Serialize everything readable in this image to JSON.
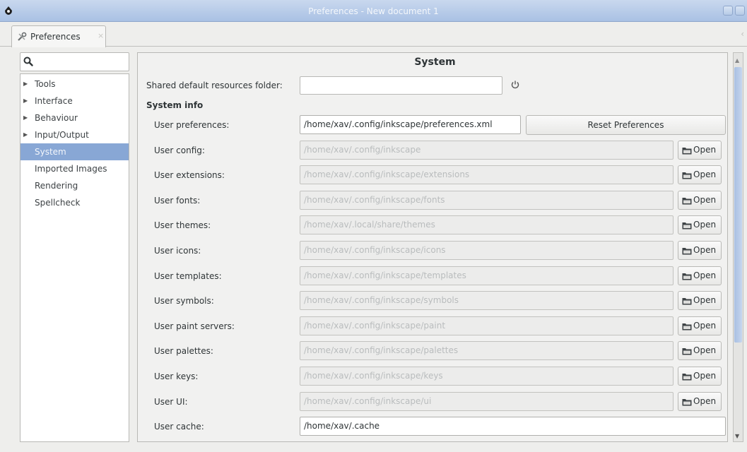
{
  "window": {
    "title": "Preferences - New document 1"
  },
  "tab": {
    "label": "Preferences",
    "close": "×"
  },
  "sidebar": {
    "search_placeholder": "",
    "items": [
      {
        "label": "Tools",
        "expandable": true,
        "selected": false
      },
      {
        "label": "Interface",
        "expandable": true,
        "selected": false
      },
      {
        "label": "Behaviour",
        "expandable": true,
        "selected": false
      },
      {
        "label": "Input/Output",
        "expandable": true,
        "selected": false
      },
      {
        "label": "System",
        "expandable": false,
        "selected": true
      },
      {
        "label": "Imported Images",
        "expandable": false,
        "selected": false
      },
      {
        "label": "Rendering",
        "expandable": false,
        "selected": false
      },
      {
        "label": "Spellcheck",
        "expandable": false,
        "selected": false
      }
    ]
  },
  "main": {
    "title": "System",
    "shared_folder_label": "Shared default resources folder:",
    "shared_folder_value": "",
    "section_header": "System info",
    "reset_button": "Reset Preferences",
    "open_label": "Open",
    "rows": [
      {
        "label": "User preferences:",
        "value": "/home/xav/.config/inkscape/preferences.xml",
        "active": true
      },
      {
        "label": "User config:",
        "value": "/home/xav/.config/inkscape",
        "active": false
      },
      {
        "label": "User extensions:",
        "value": "/home/xav/.config/inkscape/extensions",
        "active": false
      },
      {
        "label": "User fonts:",
        "value": "/home/xav/.config/inkscape/fonts",
        "active": false
      },
      {
        "label": "User themes:",
        "value": "/home/xav/.local/share/themes",
        "active": false
      },
      {
        "label": "User icons:",
        "value": "/home/xav/.config/inkscape/icons",
        "active": false
      },
      {
        "label": "User templates:",
        "value": "/home/xav/.config/inkscape/templates",
        "active": false
      },
      {
        "label": "User symbols:",
        "value": "/home/xav/.config/inkscape/symbols",
        "active": false
      },
      {
        "label": "User paint servers:",
        "value": "/home/xav/.config/inkscape/paint",
        "active": false
      },
      {
        "label": "User palettes:",
        "value": "/home/xav/.config/inkscape/palettes",
        "active": false
      },
      {
        "label": "User keys:",
        "value": "/home/xav/.config/inkscape/keys",
        "active": false
      },
      {
        "label": "User UI:",
        "value": "/home/xav/.config/inkscape/ui",
        "active": false
      },
      {
        "label": "User cache:",
        "value": "/home/xav/.cache",
        "active": true
      }
    ]
  },
  "icons": {
    "app": "inkscape-icon",
    "tab": "preferences-tools-icon",
    "search": "search-icon",
    "power": "power-icon",
    "folder": "folder-icon"
  },
  "colors": {
    "selection": "#88a7d5",
    "titlebar": "#b6cae6"
  }
}
